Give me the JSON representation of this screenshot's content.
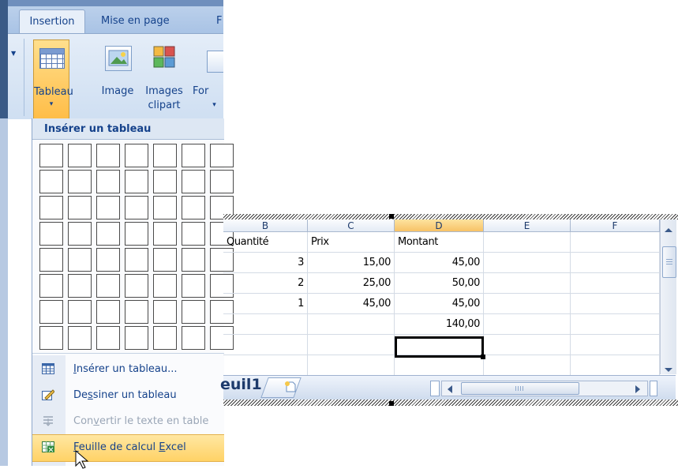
{
  "ribbon": {
    "tabs": [
      "Insertion",
      "Mise en page",
      "F"
    ],
    "buttons": {
      "tableau": {
        "line1": "Tableau",
        "line2": "▾"
      },
      "image": {
        "line1": "Image"
      },
      "clipart": {
        "line1": "Images",
        "line2": "clipart"
      },
      "formes": {
        "line1": "For",
        "line2": "▾"
      }
    }
  },
  "panel": {
    "header": "Insérer un tableau",
    "grid_cols": 7,
    "grid_rows": 8,
    "menu": [
      {
        "pre": "",
        "u": "I",
        "post": "nsérer un tableau...",
        "state": "normal"
      },
      {
        "pre": "De",
        "u": "s",
        "post": "siner un tableau",
        "state": "normal"
      },
      {
        "pre": "Con",
        "u": "v",
        "post": "ertir le texte en table",
        "state": "disabled"
      },
      {
        "pre": "",
        "u": "F",
        "post": "euille de calcul ",
        "u2": "E",
        "post2": "xcel",
        "state": "highlighted"
      }
    ]
  },
  "excel": {
    "columns": [
      "B",
      "C",
      "D",
      "E",
      "F"
    ],
    "selected_column": "D",
    "rows": [
      [
        "Quantité",
        "Prix",
        "Montant",
        "",
        ""
      ],
      [
        "3",
        "15,00",
        "45,00",
        "",
        ""
      ],
      [
        "2",
        "25,00",
        "50,00",
        "",
        ""
      ],
      [
        "1",
        "45,00",
        "45,00",
        "",
        ""
      ],
      [
        "",
        "",
        "140,00",
        "",
        ""
      ],
      [
        "",
        "",
        "",
        "",
        ""
      ],
      [
        "",
        "",
        "",
        "",
        ""
      ]
    ],
    "sheet_tab": "euil1"
  }
}
